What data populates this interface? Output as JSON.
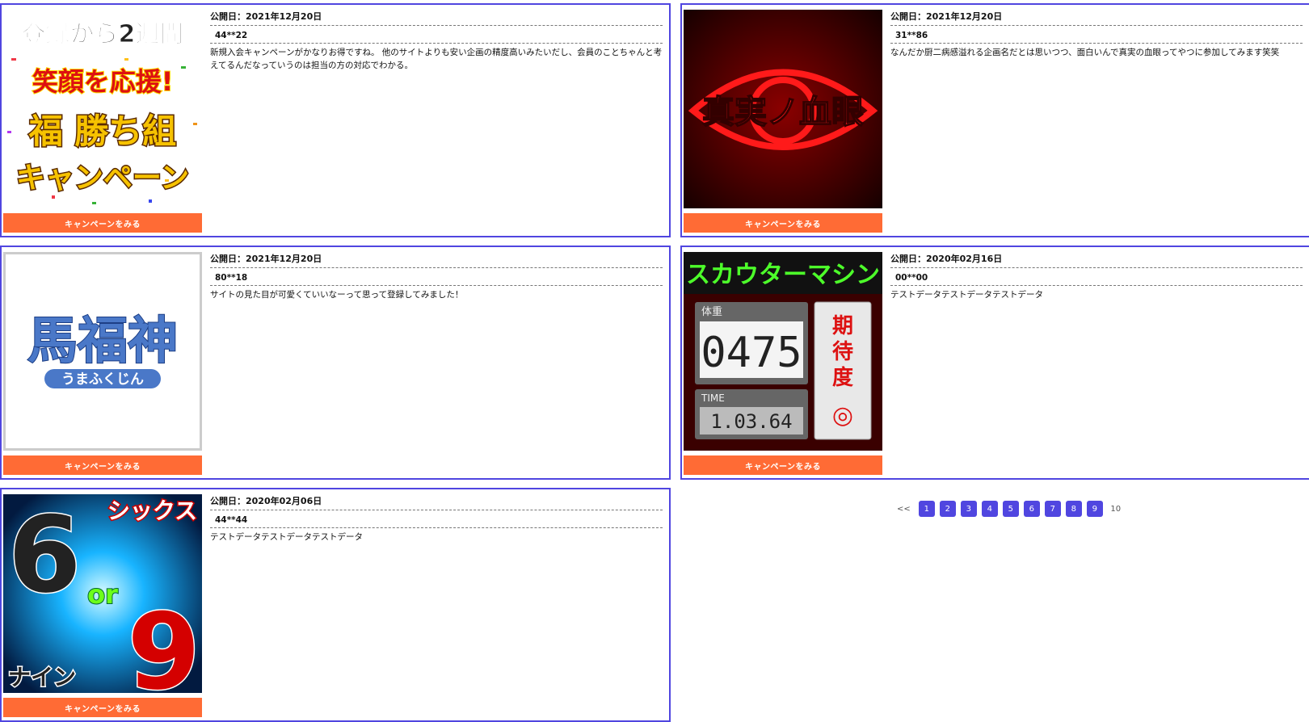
{
  "colors": {
    "card_border": "#5046e0",
    "cta": "#ff6b35",
    "pager_bg": "#5046e0"
  },
  "cta_label": "キャンペーンをみる",
  "cards": [
    {
      "pub_prefix": "公開日：",
      "date": "2021年12月20日",
      "user": "44**22",
      "comment": "新規入会キャンペーンがかなりお得ですね。 他のサイトよりも安い企画の精度高いみたいだし、会員のことちゃんと考えてるんだなっていうのは担当の方の対応でわかる。",
      "thumb": {
        "lines": [
          "登録から2週間",
          "笑顔を応援!",
          "福 勝ち組",
          "キャンペーン"
        ]
      }
    },
    {
      "pub_prefix": "公開日：",
      "date": "2021年12月20日",
      "user": "31**86",
      "comment": "なんだか厨二病感溢れる企画名だとは思いつつ、面白いんで真実の血眼ってやつに参加してみます笑笑",
      "thumb": {
        "title": "真実ノ血眼"
      }
    },
    {
      "pub_prefix": "公開日：",
      "date": "2021年12月20日",
      "user": "80**18",
      "comment": "サイトの見た目が可愛くていいなーって思って登録してみました！",
      "thumb": {
        "title": "馬福神",
        "subtitle": "うまふくじん"
      }
    },
    {
      "pub_prefix": "公開日：",
      "date": "2020年02月16日",
      "user": "00**00",
      "comment": "テストデータテストデータテストデータ",
      "thumb": {
        "title": "スカウターマシン",
        "label_weight": "体重",
        "weight": "0475",
        "label_time": "TIME",
        "time": "1.03.64",
        "expect": "期待度",
        "mark": "◎"
      }
    },
    {
      "pub_prefix": "公開日：",
      "date": "2020年02月06日",
      "user": "44**44",
      "comment": "テストデータテストデータテストデータ",
      "thumb": {
        "title": "シックス",
        "six": "6",
        "or": "or",
        "nine": "9",
        "sub": "ナイン"
      }
    }
  ],
  "pagination": {
    "prev": "<<",
    "pages": [
      "1",
      "2",
      "3",
      "4",
      "5",
      "6",
      "7",
      "8",
      "9"
    ],
    "current": "10"
  }
}
